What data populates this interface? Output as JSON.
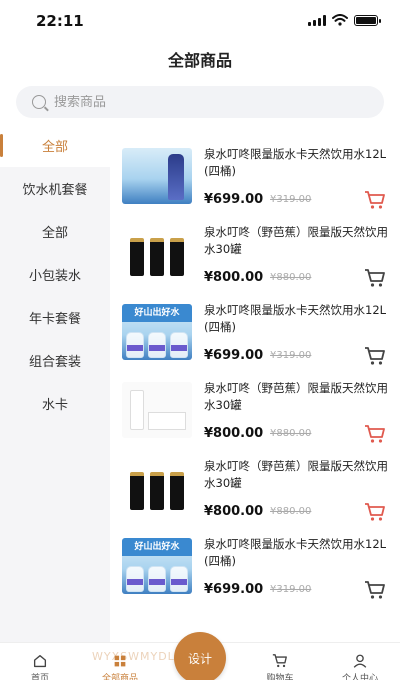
{
  "status": {
    "time": "22:11"
  },
  "header": {
    "title": "全部商品"
  },
  "search": {
    "placeholder": "搜索商品"
  },
  "sidebar": {
    "items": [
      {
        "label": "全部",
        "active": true
      },
      {
        "label": "饮水机套餐"
      },
      {
        "label": "全部"
      },
      {
        "label": "小包装水"
      },
      {
        "label": "年卡套餐"
      },
      {
        "label": "组合套装"
      },
      {
        "label": "水卡"
      }
    ]
  },
  "products": [
    {
      "name": "泉水叮咚限量版水卡天然饮用水12L (四桶)",
      "price": "¥699.00",
      "old_price": "¥319.00",
      "cart_color": "#e05a4f",
      "image": "bottle-card"
    },
    {
      "name": "泉水叮咚（野芭蕉）限量版天然饮用水30罐",
      "price": "¥800.00",
      "old_price": "¥880.00",
      "cart_color": "#444444",
      "image": "black-cans"
    },
    {
      "name": "泉水叮咚限量版水卡天然饮用水12L (四桶)",
      "price": "¥699.00",
      "old_price": "¥319.00",
      "cart_color": "#444444",
      "image": "water-jugs"
    },
    {
      "name": "泉水叮咚（野芭蕉）限量版天然饮用水30罐",
      "price": "¥800.00",
      "old_price": "¥880.00",
      "cart_color": "#e05a4f",
      "image": "white-box"
    },
    {
      "name": "泉水叮咚（野芭蕉）限量版天然饮用水30罐",
      "price": "¥800.00",
      "old_price": "¥880.00",
      "cart_color": "#e05a4f",
      "image": "black-cans"
    },
    {
      "name": "泉水叮咚限量版水卡天然饮用水12L (四桶)",
      "price": "¥699.00",
      "old_price": "¥319.00",
      "cart_color": "#444444",
      "image": "water-jugs"
    }
  ],
  "thumb_text": {
    "jug_brand": "好山出好水"
  },
  "float_button": {
    "label": "设计"
  },
  "tabbar": {
    "items": [
      {
        "label": "首页",
        "icon": "home-icon"
      },
      {
        "label": "全部商品",
        "icon": "grid-icon",
        "active": true
      },
      {
        "label": "",
        "icon": ""
      },
      {
        "label": "购物车",
        "icon": "cart-icon"
      },
      {
        "label": "个人中心",
        "icon": "user-icon"
      }
    ]
  },
  "watermark": "WYXSWMYDLOWN",
  "colors": {
    "accent": "#c9803b",
    "cart_active": "#e05a4f"
  }
}
